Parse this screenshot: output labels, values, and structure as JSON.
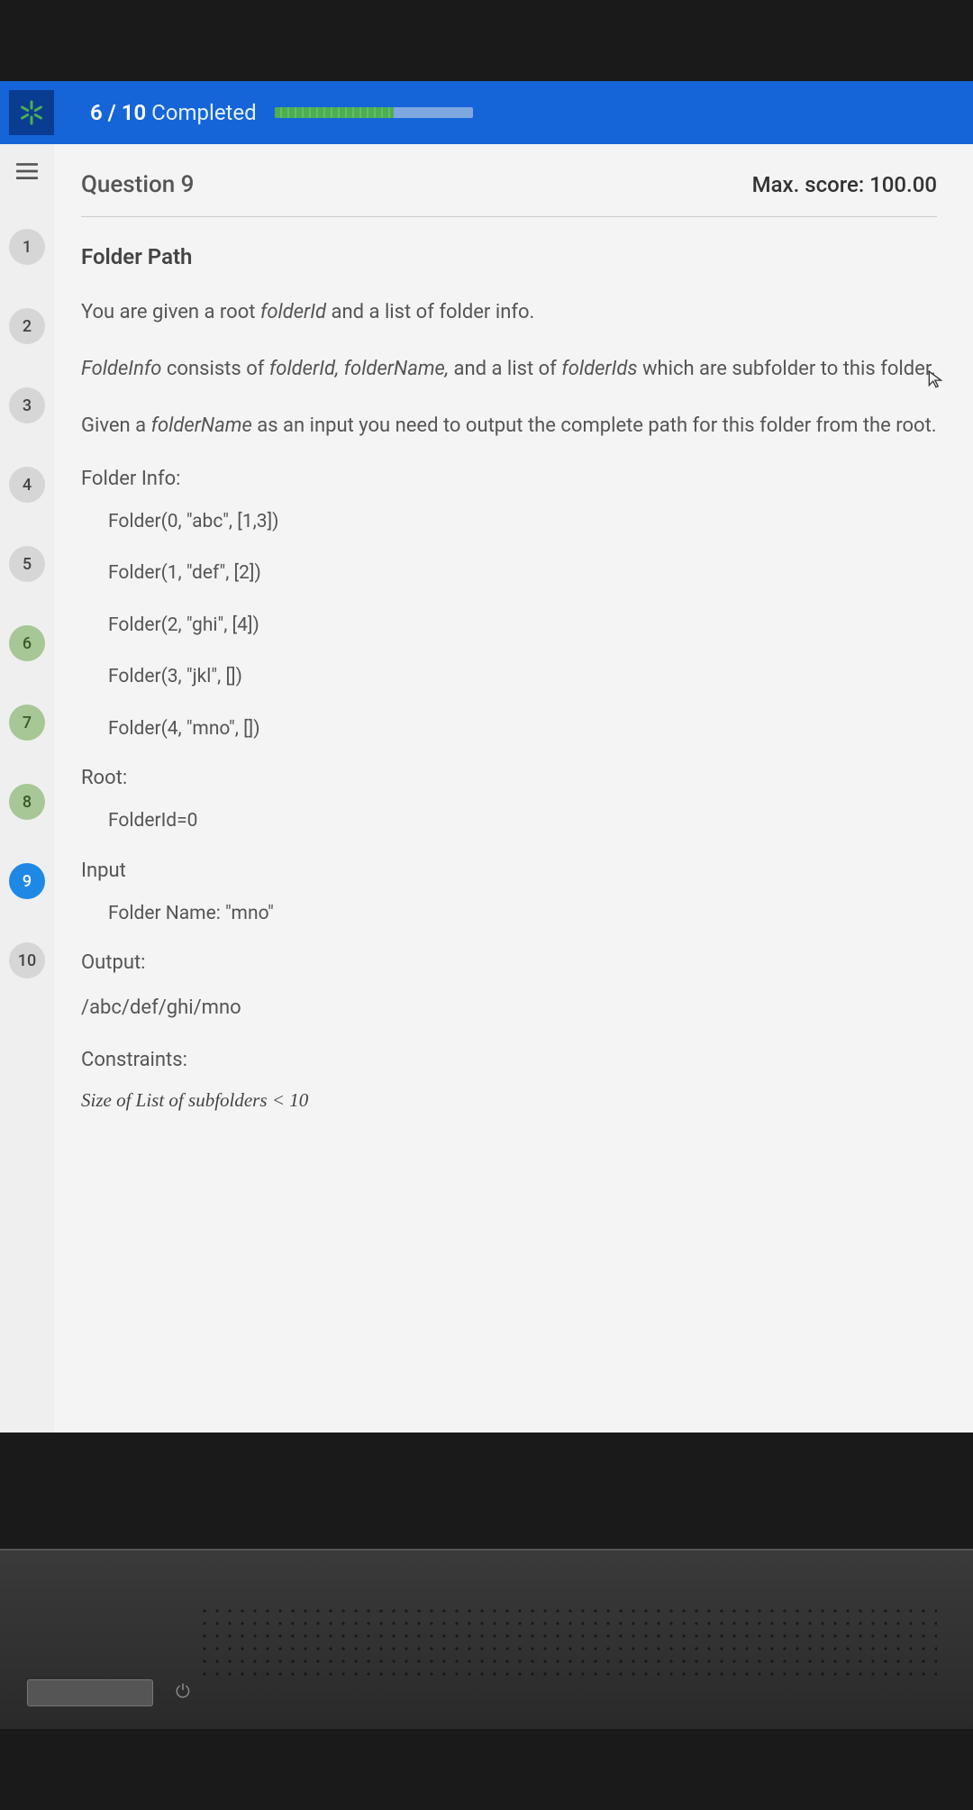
{
  "header": {
    "completed_count": "6 / 10",
    "completed_label": "Completed",
    "progress_percent": 60
  },
  "sidebar": {
    "items": [
      {
        "n": "1",
        "state": "default"
      },
      {
        "n": "2",
        "state": "default"
      },
      {
        "n": "3",
        "state": "default"
      },
      {
        "n": "4",
        "state": "default"
      },
      {
        "n": "5",
        "state": "default"
      },
      {
        "n": "6",
        "state": "done"
      },
      {
        "n": "7",
        "state": "done"
      },
      {
        "n": "8",
        "state": "done"
      },
      {
        "n": "9",
        "state": "active"
      },
      {
        "n": "10",
        "state": "default"
      }
    ]
  },
  "question": {
    "label": "Question  9",
    "max_score": "Max. score: 100.00",
    "title": "Folder Path",
    "p1_a": "You are given a root ",
    "p1_i": "folderId",
    "p1_b": " and a list of folder info.",
    "p2_i1": "FoldeInfo",
    "p2_a": " consists of ",
    "p2_i2": "folderId, folderName,",
    "p2_b": " and a list of ",
    "p2_i3": "folderIds",
    "p2_c": " which are subfolder to this folder.",
    "p3_a": "Given a ",
    "p3_i": "folderName",
    "p3_b": " as an input you need to output the complete path for this folder from the root.",
    "info_label": "Folder Info:",
    "folders": [
      "Folder(0, \"abc\", [1,3])",
      "Folder(1, \"def\", [2])",
      "Folder(2, \"ghi\", [4])",
      "Folder(3, \"jkl\", [])",
      "Folder(4, \"mno\", [])"
    ],
    "root_label": "Root:",
    "root_value": "FolderId=0",
    "input_label": "Input",
    "input_value": "Folder Name: \"mno\"",
    "output_label": "Output:",
    "output_value": "/abc/def/ghi/mno",
    "constraints_label": "Constraints:",
    "constraint_line": "Size of List of subfolders < 10"
  }
}
